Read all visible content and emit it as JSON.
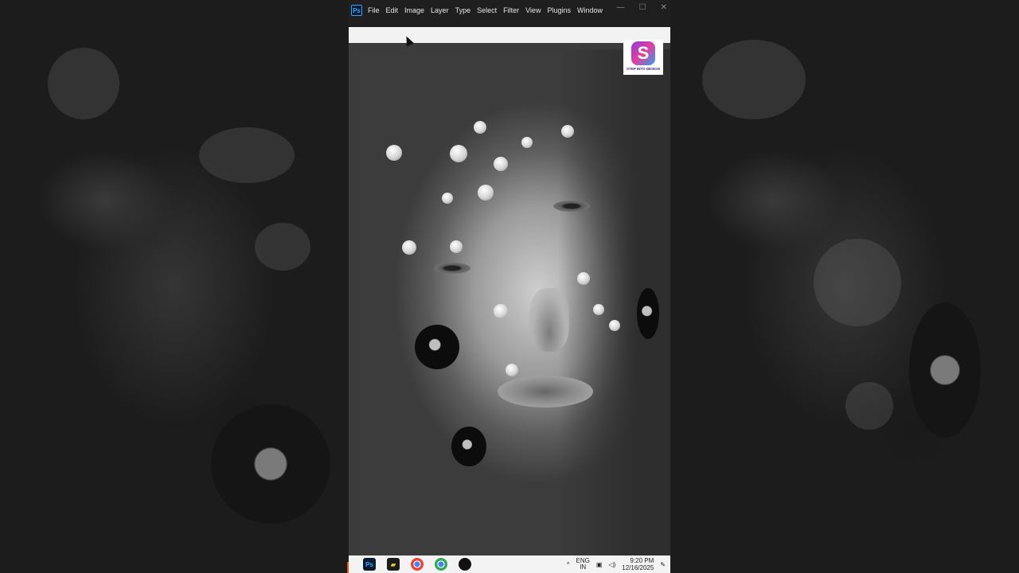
{
  "app": {
    "name": "Adobe Photoshop",
    "logo_text": "Ps"
  },
  "menubar": {
    "items": [
      "File",
      "Edit",
      "Image",
      "Layer",
      "Type",
      "Select",
      "Filter",
      "View",
      "Plugins",
      "Window"
    ]
  },
  "window_controls": {
    "minimize": "—",
    "maximize": "☐",
    "close": "✕"
  },
  "brand_badge": {
    "letter": "S",
    "text": "STEP INTO DESIGN"
  },
  "taskbar": {
    "ps_label": "Ps",
    "language": "ENG",
    "language_sub": "IN",
    "time": "9:20 PM",
    "date": "12/16/2025"
  },
  "colors": {
    "ps_blue": "#31a8ff",
    "menubar_bg": "#1f1f1f",
    "taskbar_bg": "#f3f3f3"
  }
}
